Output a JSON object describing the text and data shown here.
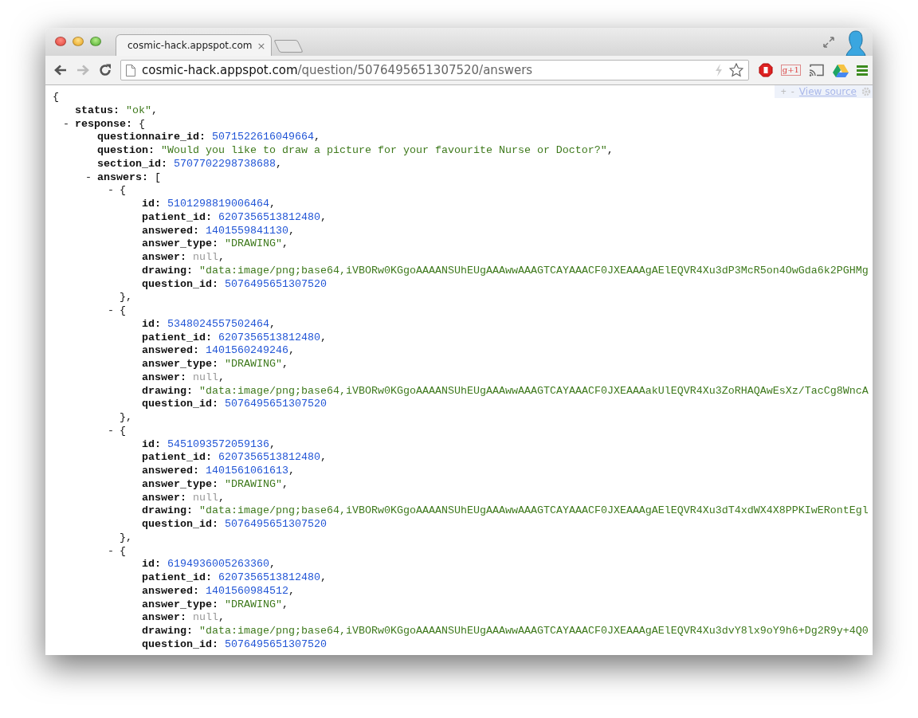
{
  "window": {
    "controls": [
      {
        "kind": "close"
      },
      {
        "kind": "minimize"
      },
      {
        "kind": "zoom"
      }
    ]
  },
  "tabs": [
    {
      "title": "cosmic-hack.appspot.com",
      "close": "×",
      "selected": true
    }
  ],
  "toolbar": {
    "back_enabled": true,
    "forward_enabled": false,
    "url_host": "cosmic-hack.appspot.com",
    "url_path": "/question/5076495651307520/answers",
    "extension_badge": "g+1"
  },
  "view_source": {
    "expand": "+",
    "collapse": "-",
    "link": "View source"
  },
  "json": {
    "kind": "object",
    "open": "{",
    "children": [
      {
        "kind": "string",
        "key": "status:",
        "value": "\"ok\"",
        "sep": ","
      },
      {
        "kind": "object",
        "toggle": "-",
        "key": "response:",
        "open": "{",
        "children": [
          {
            "kind": "number",
            "key": "questionnaire_id:",
            "value": "5071522616049664",
            "sep": ","
          },
          {
            "kind": "string",
            "key": "question:",
            "value": "\"Would you like to draw a picture for your favourite Nurse or Doctor?\"",
            "sep": ","
          },
          {
            "kind": "number",
            "key": "section_id:",
            "value": "5707702298738688",
            "sep": ","
          },
          {
            "kind": "object",
            "toggle": "-",
            "key": "answers:",
            "open": "[",
            "children": [
              {
                "kind": "object",
                "toggle": "-",
                "open": "{",
                "close": "},",
                "children": [
                  {
                    "kind": "number",
                    "key": "id:",
                    "value": "5101298819006464",
                    "sep": ","
                  },
                  {
                    "kind": "number",
                    "key": "patient_id:",
                    "value": "6207356513812480",
                    "sep": ","
                  },
                  {
                    "kind": "number",
                    "key": "answered:",
                    "value": "1401559841130",
                    "sep": ","
                  },
                  {
                    "kind": "string",
                    "key": "answer_type:",
                    "value": "\"DRAWING\"",
                    "sep": ","
                  },
                  {
                    "kind": "null",
                    "key": "answer:",
                    "value": "null",
                    "sep": ","
                  },
                  {
                    "kind": "string",
                    "key": "drawing:",
                    "value": "\"data:image/png;base64,iVBORw0KGgoAAAANSUhEUgAAAwwAAAGTCAYAAACF0JXEAAAgAElEQVR4Xu3dP3McR5on4OwGda6k2PGHMg"
                  },
                  {
                    "kind": "number",
                    "key": "question_id:",
                    "value": "5076495651307520"
                  }
                ]
              },
              {
                "kind": "object",
                "toggle": "-",
                "open": "{",
                "close": "},",
                "children": [
                  {
                    "kind": "number",
                    "key": "id:",
                    "value": "5348024557502464",
                    "sep": ","
                  },
                  {
                    "kind": "number",
                    "key": "patient_id:",
                    "value": "6207356513812480",
                    "sep": ","
                  },
                  {
                    "kind": "number",
                    "key": "answered:",
                    "value": "1401560249246",
                    "sep": ","
                  },
                  {
                    "kind": "string",
                    "key": "answer_type:",
                    "value": "\"DRAWING\"",
                    "sep": ","
                  },
                  {
                    "kind": "null",
                    "key": "answer:",
                    "value": "null",
                    "sep": ","
                  },
                  {
                    "kind": "string",
                    "key": "drawing:",
                    "value": "\"data:image/png;base64,iVBORw0KGgoAAAANSUhEUgAAAwwAAAGTCAYAAACF0JXEAAAakUlEQVR4Xu3ZoRHAQAwEsXz/TacCg8WncA"
                  },
                  {
                    "kind": "number",
                    "key": "question_id:",
                    "value": "5076495651307520"
                  }
                ]
              },
              {
                "kind": "object",
                "toggle": "-",
                "open": "{",
                "close": "},",
                "children": [
                  {
                    "kind": "number",
                    "key": "id:",
                    "value": "5451093572059136",
                    "sep": ","
                  },
                  {
                    "kind": "number",
                    "key": "patient_id:",
                    "value": "6207356513812480",
                    "sep": ","
                  },
                  {
                    "kind": "number",
                    "key": "answered:",
                    "value": "1401561061613",
                    "sep": ","
                  },
                  {
                    "kind": "string",
                    "key": "answer_type:",
                    "value": "\"DRAWING\"",
                    "sep": ","
                  },
                  {
                    "kind": "null",
                    "key": "answer:",
                    "value": "null",
                    "sep": ","
                  },
                  {
                    "kind": "string",
                    "key": "drawing:",
                    "value": "\"data:image/png;base64,iVBORw0KGgoAAAANSUhEUgAAAwwAAAGTCAYAAACF0JXEAAAgAElEQVR4Xu3dT4xdWX4X8PPKIwERontEgl"
                  },
                  {
                    "kind": "number",
                    "key": "question_id:",
                    "value": "5076495651307520"
                  }
                ]
              },
              {
                "kind": "object",
                "toggle": "-",
                "open": "{",
                "children": [
                  {
                    "kind": "number",
                    "key": "id:",
                    "value": "6194936005263360",
                    "sep": ","
                  },
                  {
                    "kind": "number",
                    "key": "patient_id:",
                    "value": "6207356513812480",
                    "sep": ","
                  },
                  {
                    "kind": "number",
                    "key": "answered:",
                    "value": "1401560984512",
                    "sep": ","
                  },
                  {
                    "kind": "string",
                    "key": "answer_type:",
                    "value": "\"DRAWING\"",
                    "sep": ","
                  },
                  {
                    "kind": "null",
                    "key": "answer:",
                    "value": "null",
                    "sep": ","
                  },
                  {
                    "kind": "string",
                    "key": "drawing:",
                    "value": "\"data:image/png;base64,iVBORw0KGgoAAAANSUhEUgAAAwwAAAGTCAYAAACF0JXEAAAgAElEQVR4Xu3dvY8lx9oY9h6+Dg2R9y+4Q0"
                  },
                  {
                    "kind": "number",
                    "key": "question_id:",
                    "value": "5076495651307520"
                  }
                ]
              }
            ]
          }
        ]
      }
    ]
  }
}
